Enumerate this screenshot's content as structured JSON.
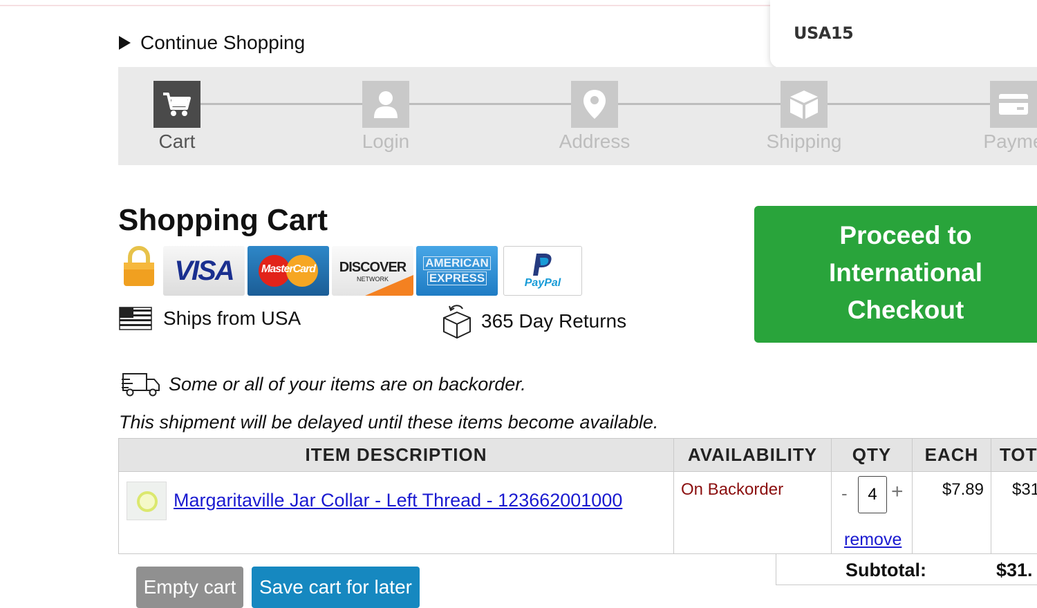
{
  "coupon": {
    "code": "USA15"
  },
  "nav": {
    "continue_label": "Continue Shopping"
  },
  "steps": [
    {
      "label": "Cart",
      "icon": "cart-icon",
      "active": true
    },
    {
      "label": "Login",
      "icon": "user-icon",
      "active": false
    },
    {
      "label": "Address",
      "icon": "map-pin-icon",
      "active": false
    },
    {
      "label": "Shipping",
      "icon": "box-icon",
      "active": false
    },
    {
      "label": "Payme",
      "icon": "credit-card-icon",
      "active": false
    }
  ],
  "page": {
    "title": "Shopping Cart"
  },
  "payment_methods": {
    "visa": "VISA",
    "mastercard": "MasterCard",
    "discover": "DISCOVER",
    "discover_sub": "NETWORK",
    "amex_top": "AMERICAN",
    "amex_bottom": "EXPRESS",
    "paypal": "PayPal"
  },
  "badges": {
    "ships": "Ships from USA",
    "returns": "365 Day Returns"
  },
  "checkout": {
    "label": "Proceed to\nInternational\nCheckout"
  },
  "notice": {
    "backorder": "Some or all of your items are on backorder.",
    "delay": "This shipment will be delayed until these items become available."
  },
  "table": {
    "headers": {
      "item": "ITEM DESCRIPTION",
      "availability": "AVAILABILITY",
      "qty": "QTY",
      "each": "EACH",
      "total": "TOT"
    },
    "rows": [
      {
        "name": "Margaritaville Jar Collar - Left Thread - 123662001000",
        "availability": "On Backorder",
        "qty": "4",
        "each": "$7.89",
        "total": "$31",
        "remove": "remove",
        "minus": "-",
        "plus": "+"
      }
    ]
  },
  "summary": {
    "subtotal_label": "Subtotal:",
    "subtotal_value": "$31."
  },
  "actions": {
    "empty": "Empty cart",
    "save": "Save cart for later"
  },
  "colors": {
    "checkout_green": "#29a43b",
    "save_blue": "#1688c0",
    "backorder_red": "#8b1010",
    "link_blue": "#1a1ad0"
  }
}
